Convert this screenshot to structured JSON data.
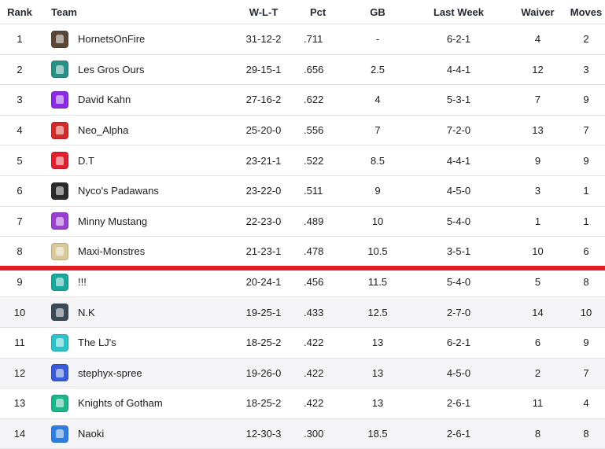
{
  "headers": {
    "rank": "Rank",
    "team": "Team",
    "wlt": "W-L-T",
    "pct": "Pct",
    "gb": "GB",
    "last_week": "Last Week",
    "waiver": "Waiver",
    "moves": "Moves"
  },
  "teams": [
    {
      "rank": "1",
      "name": "HornetsOnFire",
      "wlt": "31-12-2",
      "pct": ".711",
      "gb": "-",
      "last_week": "6-2-1",
      "waiver": "4",
      "moves": "2",
      "logo_color": "#5a4636",
      "logo_icon": "car-icon"
    },
    {
      "rank": "2",
      "name": "Les Gros Ours",
      "wlt": "29-15-1",
      "pct": ".656",
      "gb": "2.5",
      "last_week": "4-4-1",
      "waiver": "12",
      "moves": "3",
      "logo_color": "#2a8f84",
      "logo_icon": "bear-icon"
    },
    {
      "rank": "3",
      "name": "David Kahn",
      "wlt": "27-16-2",
      "pct": ".622",
      "gb": "4",
      "last_week": "5-3-1",
      "waiver": "7",
      "moves": "9",
      "logo_color": "#8a2be2",
      "logo_icon": "jersey-icon"
    },
    {
      "rank": "4",
      "name": "Neo_Alpha",
      "wlt": "25-20-0",
      "pct": ".556",
      "gb": "7",
      "last_week": "7-2-0",
      "waiver": "13",
      "moves": "7",
      "logo_color": "#d42a2a",
      "logo_icon": "ball-icon"
    },
    {
      "rank": "5",
      "name": "D.T",
      "wlt": "23-21-1",
      "pct": ".522",
      "gb": "8.5",
      "last_week": "4-4-1",
      "waiver": "9",
      "moves": "9",
      "logo_color": "#e0202f",
      "logo_icon": "badge-icon"
    },
    {
      "rank": "6",
      "name": "Nyco's Padawans",
      "wlt": "23-22-0",
      "pct": ".511",
      "gb": "9",
      "last_week": "4-5-0",
      "waiver": "3",
      "moves": "1",
      "logo_color": "#2b2b2b",
      "logo_icon": "figure-icon"
    },
    {
      "rank": "7",
      "name": "Minny Mustang",
      "wlt": "22-23-0",
      "pct": ".489",
      "gb": "10",
      "last_week": "5-4-0",
      "waiver": "1",
      "moves": "1",
      "logo_color": "#9b3fd1",
      "logo_icon": "jersey-icon"
    },
    {
      "rank": "8",
      "name": "Maxi-Monstres",
      "wlt": "21-23-1",
      "pct": ".478",
      "gb": "10.5",
      "last_week": "3-5-1",
      "waiver": "10",
      "moves": "6",
      "logo_color": "#d8c89a",
      "logo_icon": "monster-icon"
    },
    {
      "rank": "9",
      "name": "!!!",
      "wlt": "20-24-1",
      "pct": ".456",
      "gb": "11.5",
      "last_week": "5-4-0",
      "waiver": "5",
      "moves": "8",
      "logo_color": "#1ba89c",
      "logo_icon": "jersey-icon"
    },
    {
      "rank": "10",
      "name": "N.K",
      "wlt": "19-25-1",
      "pct": ".433",
      "gb": "12.5",
      "last_week": "2-7-0",
      "waiver": "14",
      "moves": "10",
      "logo_color": "#3c4a57",
      "logo_icon": "jersey-icon"
    },
    {
      "rank": "11",
      "name": "The LJ's",
      "wlt": "18-25-2",
      "pct": ".422",
      "gb": "13",
      "last_week": "6-2-1",
      "waiver": "6",
      "moves": "9",
      "logo_color": "#2bc3c9",
      "logo_icon": "jersey-icon"
    },
    {
      "rank": "12",
      "name": "stephyx-spree",
      "wlt": "19-26-0",
      "pct": ".422",
      "gb": "13",
      "last_week": "4-5-0",
      "waiver": "2",
      "moves": "7",
      "logo_color": "#3a5bd9",
      "logo_icon": "jersey-icon"
    },
    {
      "rank": "13",
      "name": "Knights of Gotham",
      "wlt": "18-25-2",
      "pct": ".422",
      "gb": "13",
      "last_week": "2-6-1",
      "waiver": "11",
      "moves": "4",
      "logo_color": "#1fb58a",
      "logo_icon": "jersey-icon"
    },
    {
      "rank": "14",
      "name": "Naoki",
      "wlt": "12-30-3",
      "pct": ".300",
      "gb": "18.5",
      "last_week": "2-6-1",
      "waiver": "8",
      "moves": "8",
      "logo_color": "#2f7de1",
      "logo_icon": "jersey-icon"
    }
  ],
  "colors": {
    "cutline": "#e31b23",
    "row_shade": "#f5f5f7",
    "border": "#e4e4e8"
  }
}
